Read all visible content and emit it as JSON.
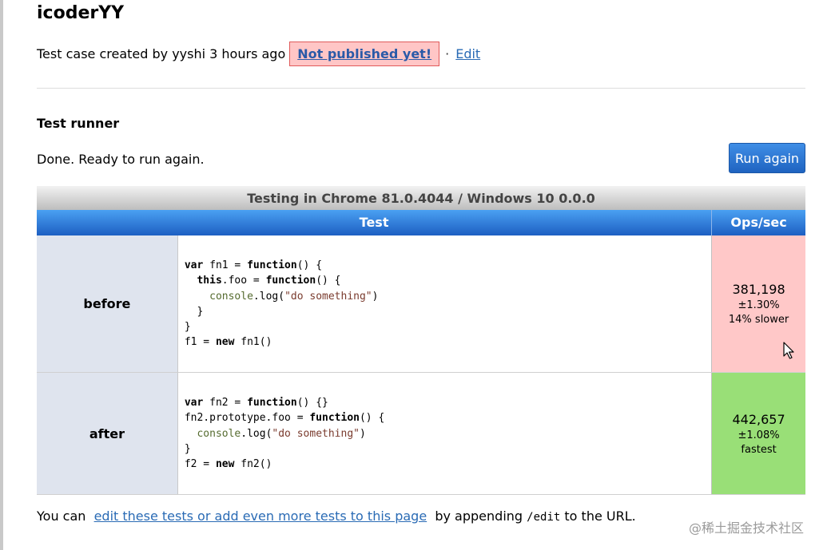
{
  "page": {
    "title": "icoderYY",
    "meta_prefix": "Test case created by yyshi 3 hours ago",
    "not_published": "Not published yet!",
    "separator": "·",
    "edit_link": "Edit"
  },
  "runner": {
    "heading": "Test runner",
    "status": "Done. Ready to run again.",
    "run_button": "Run again"
  },
  "table": {
    "caption": "Testing in Chrome 81.0.4044 / Windows 10 0.0.0",
    "col_test": "Test",
    "col_ops": "Ops/sec",
    "rows": [
      {
        "title": "before",
        "code": [
          "var fn1 = function() {",
          "  this.foo = function() {",
          "    console.log(\"do something\")",
          "  }",
          "}",
          "f1 = new fn1()"
        ],
        "ops": "381,198",
        "rme": "±1.30%",
        "note": "14% slower",
        "status_color": "#ffc8c8"
      },
      {
        "title": "after",
        "code": [
          "var fn2 = function() {}",
          "fn2.prototype.foo = function() {",
          "  console.log(\"do something\")",
          "}",
          "f2 = new fn2()"
        ],
        "ops": "442,657",
        "rme": "±1.08%",
        "note": "fastest",
        "status_color": "#99df77"
      }
    ]
  },
  "footer": {
    "prefix": "You can",
    "link": "edit these tests or add even more tests to this page",
    "middle": "by appending",
    "code": "/edit",
    "suffix": "to the URL."
  },
  "watermark": "@稀土掘金技术社区",
  "icons": {
    "cursor": "mouse-pointer-icon"
  }
}
